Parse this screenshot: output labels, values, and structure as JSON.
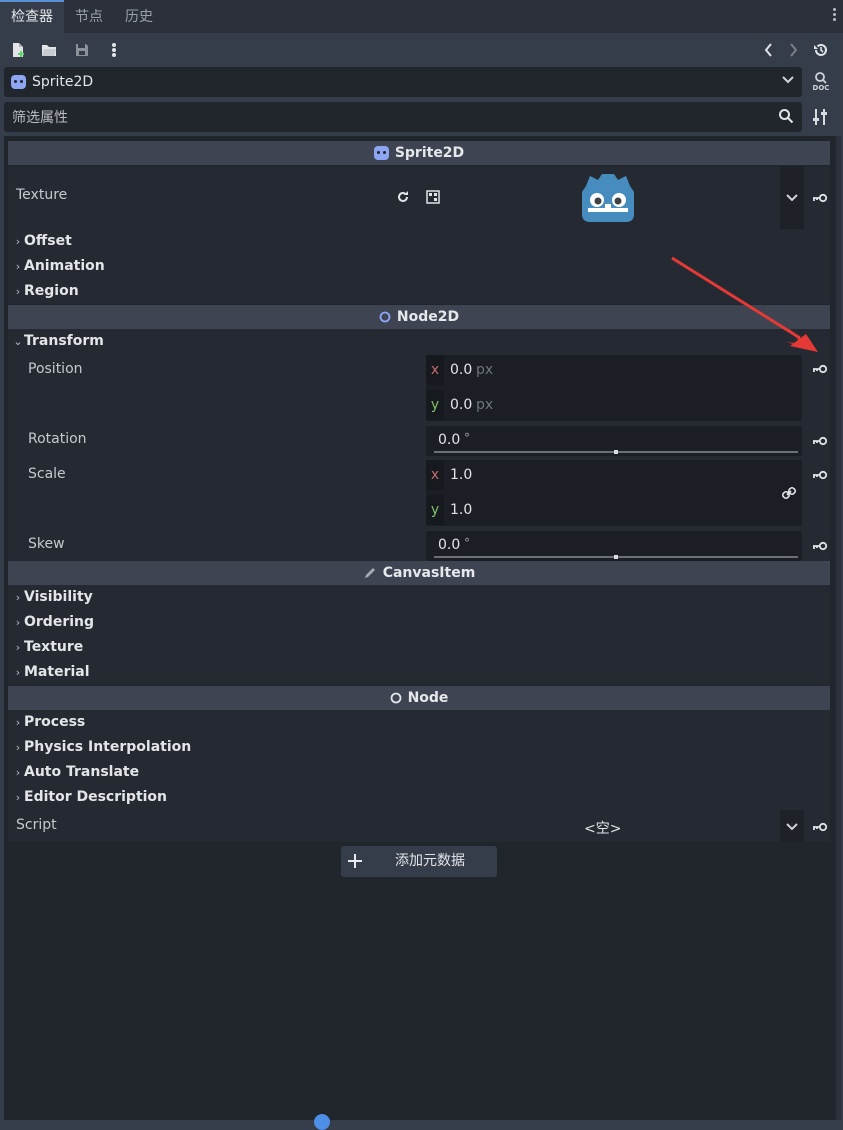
{
  "tabs": [
    {
      "label": "检查器",
      "active": true
    },
    {
      "label": "节点",
      "active": false
    },
    {
      "label": "历史",
      "active": false
    }
  ],
  "toolbar": {
    "icons": [
      "new-resource-icon",
      "open-folder-icon",
      "save-icon",
      "more-vertical-icon",
      "back-arrow-icon",
      "forward-arrow-icon",
      "history-icon"
    ]
  },
  "node_selector": {
    "value": "Sprite2D",
    "doc_label": "DOC"
  },
  "filter": {
    "placeholder": "筛选属性"
  },
  "sections": {
    "sprite2d": "Sprite2D",
    "node2d": "Node2D",
    "canvasitem": "CanvasItem",
    "node": "Node"
  },
  "texture": {
    "label": "Texture"
  },
  "sprite_categories": [
    "Offset",
    "Animation",
    "Region"
  ],
  "transform": {
    "title": "Transform",
    "position": {
      "label": "Position",
      "x_axis": "x",
      "x": "0.0",
      "x_unit": "px",
      "y_axis": "y",
      "y": "0.0",
      "y_unit": "px"
    },
    "rotation": {
      "label": "Rotation",
      "value": "0.0",
      "unit": "°",
      "slider": 0.5
    },
    "scale": {
      "label": "Scale",
      "x_axis": "x",
      "x": "1.0",
      "y_axis": "y",
      "y": "1.0"
    },
    "skew": {
      "label": "Skew",
      "value": "0.0",
      "unit": "°",
      "slider": 0.5
    }
  },
  "canvas_categories": [
    "Visibility",
    "Ordering",
    "Texture",
    "Material"
  ],
  "node_categories": [
    "Process",
    "Physics Interpolation",
    "Auto Translate",
    "Editor Description"
  ],
  "script": {
    "label": "Script",
    "value": "<空>"
  },
  "add_metadata": {
    "label": "添加元数据"
  },
  "colors": {
    "accent": "#5a8fd6",
    "annotation_arrow": "#e53935"
  }
}
